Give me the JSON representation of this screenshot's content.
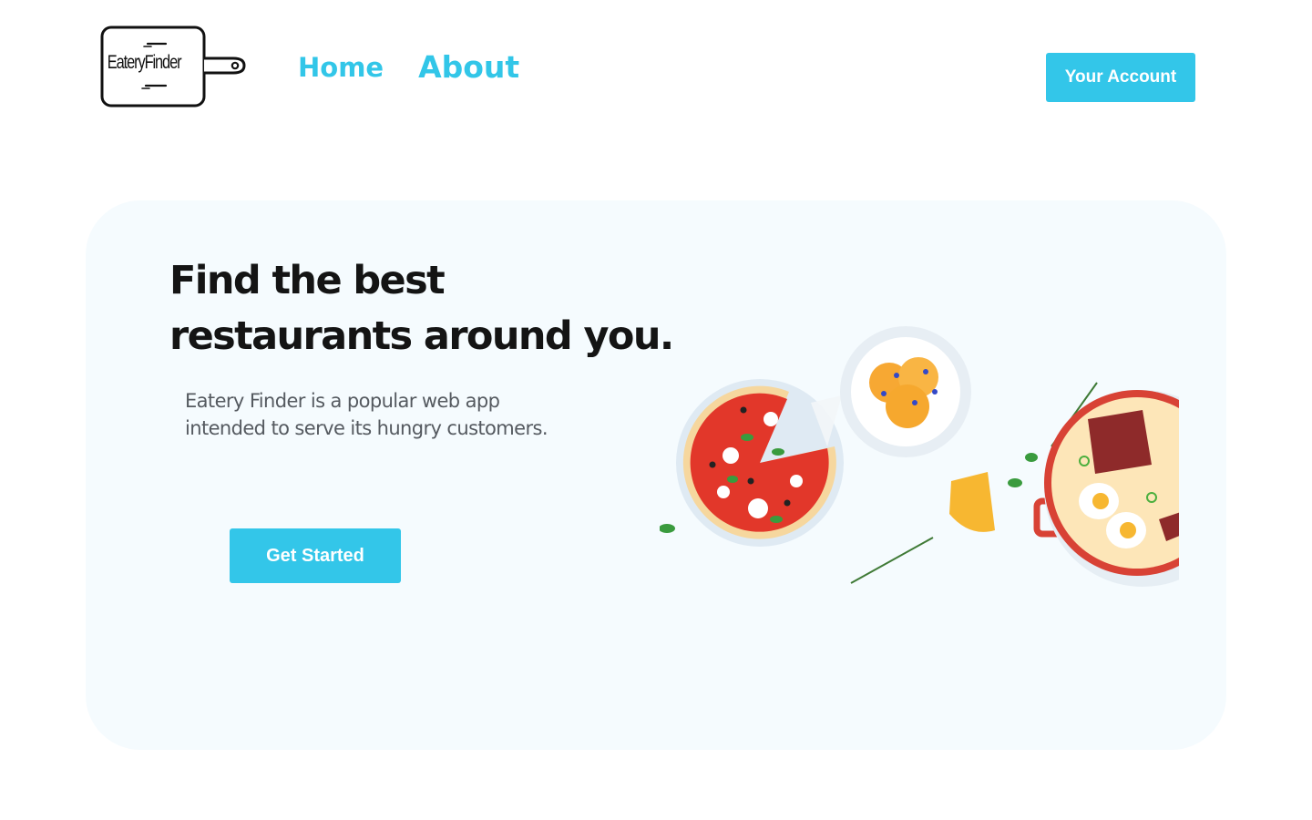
{
  "header": {
    "logo_text": "EateryFinder",
    "nav": [
      {
        "label": "Home"
      },
      {
        "label": "About"
      }
    ],
    "account_button": "Your Account"
  },
  "hero": {
    "title_line1": "Find the best",
    "title_line2": "restaurants around you.",
    "description": "Eatery Finder is a popular web app intended to serve its hungry customers.",
    "cta_button": "Get Started",
    "illustration": "food-illustration"
  },
  "colors": {
    "accent": "#33c6e9",
    "hero_background": "#f5fbfe",
    "heading": "#141414",
    "body_text": "#555a60"
  }
}
